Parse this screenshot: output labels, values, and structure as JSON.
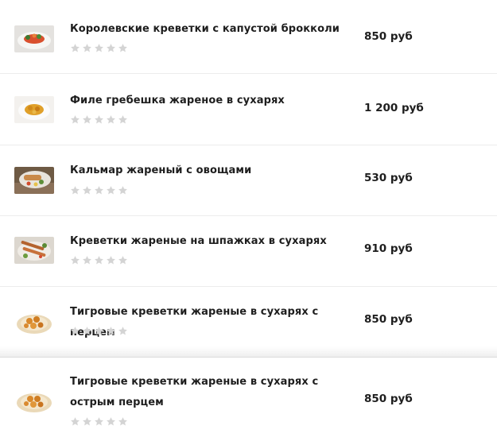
{
  "menu_items": [
    {
      "name": "Королевские креветки с капустой брокколи",
      "price": "850 руб",
      "rating": 0,
      "image": "king-prawns-broccoli-photo"
    },
    {
      "name": "Филе гребешка жареное в сухарях",
      "price": "1 200 руб",
      "rating": 0,
      "image": "fried-scallop-fillet-photo"
    },
    {
      "name": "Кальмар жареный с овощами",
      "price": "530 руб",
      "rating": 0,
      "image": "fried-squid-vegetables-photo"
    },
    {
      "name": "Креветки жареные на шпажках в сухарях",
      "price": "910 руб",
      "rating": 0,
      "image": "shrimp-skewers-photo"
    },
    {
      "name": "Тигровые креветки жареные в сухарях с перцем",
      "price": "850 руб",
      "rating": 0,
      "image": "tiger-prawns-pepper-photo"
    },
    {
      "name": "Тигровые креветки жареные в сухарях с острым перцем",
      "price": "850 руб",
      "rating": 0,
      "image": "tiger-prawns-hot-pepper-photo"
    }
  ],
  "colors": {
    "star_empty": "#d4d4d4",
    "divider": "#ececec",
    "text": "#1e1e1e"
  },
  "icons": {
    "rating": "star-icon"
  }
}
